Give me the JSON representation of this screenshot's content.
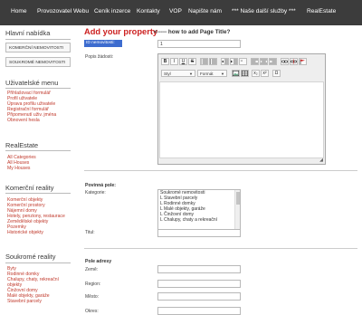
{
  "nav": {
    "items": [
      "Home",
      "Provozovatel Webu",
      "Ceník inzerce",
      "Kontakty",
      "VOP",
      "Napište nám",
      "*** Naše další služby ***",
      "RealEstate"
    ]
  },
  "sidebar": {
    "main_menu": {
      "title": "Hlavní nabídka",
      "items": [
        "KOMERČNÍ NEMOVITOSTI",
        "SOUKROMÉ NEMOVITOSTI"
      ]
    },
    "user_menu": {
      "title": "Uživatelské menu",
      "items": [
        "Přihlašovací formulář",
        "Profil uživatele",
        "Úprava profilu uživatele",
        "Registrační formulář",
        "Připomenutí uživ. jména",
        "Obnovení hesla"
      ]
    },
    "realestate": {
      "title": "RealEstate",
      "items": [
        "All Categories",
        "All Houses",
        "My Houses"
      ]
    },
    "commercial": {
      "title": "Komerční reality",
      "items": [
        "Komerční objekty",
        "Komerční prostory",
        "Nájemní domy",
        "Hotely, penziony, restaurace",
        "Zemědělské objekty",
        "Pozemky",
        "Historické objekty"
      ]
    },
    "private": {
      "title": "Soukromé reality",
      "items": [
        "Byty",
        "Rodinné domky",
        "Chalupy, chaty, rekreační objekty",
        "Činžovní domy",
        "Malé objekty, garáže",
        "Stavební parcely"
      ]
    }
  },
  "form": {
    "title": "Add your property",
    "subtitle": "<----- how to add Page Title?",
    "id_label": "ID nemovitosti:",
    "id_value": "1",
    "description_label": "Popis žádosti:",
    "toolbar": {
      "bold": "B",
      "italic": "I",
      "underline": "U",
      "strike": "S",
      "style_label": "Styl",
      "format_label": "Formát",
      "subscript": "x₂",
      "superscript": "x²",
      "omega": "Ω"
    },
    "required_title": "Povinná pole:",
    "category_label": "Kategorie:",
    "categories": [
      "Soukromé nemovitosti",
      "L Stavební parcely",
      "L Rodinné domky",
      "L Malé objekty, garáže",
      "L Činžovní domy",
      "L Chalupy, chaty a rekreační"
    ],
    "title_label": "Titul:",
    "address_title": "Pole adresy",
    "country_label": "Země:",
    "region_label": "Region:",
    "city_label": "Město:",
    "district_label": "Okres:"
  }
}
